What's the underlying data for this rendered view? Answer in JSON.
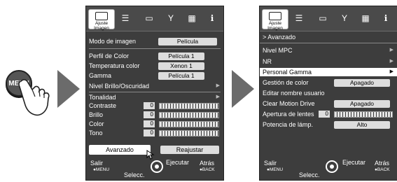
{
  "menu_button": "MENU",
  "panel1": {
    "tab_label": "Ajuste Imagen",
    "picture_mode": {
      "label": "Modo de imagen",
      "value": "Película"
    },
    "rows": [
      {
        "label": "Perfil de Color",
        "value": "Película 1"
      },
      {
        "label": "Temperatura color",
        "value": "Xenon 1"
      },
      {
        "label": "Gamma",
        "value": "Película 1"
      },
      {
        "label": "Nivel Brillo/Oscuridad"
      },
      {
        "label": "Tonalidad"
      }
    ],
    "sliders": [
      {
        "label": "Contraste",
        "value": "0"
      },
      {
        "label": "Brillo",
        "value": "0"
      },
      {
        "label": "Color",
        "value": "0"
      },
      {
        "label": "Tono",
        "value": "0"
      }
    ],
    "advanced_button": "Avanzado",
    "reset_button": "Reajustar"
  },
  "panel2": {
    "tab_label": "Ajuste Imagen",
    "section_header": "> Avanzado",
    "rows": [
      {
        "label": "Nivel MPC"
      },
      {
        "label": "NR"
      },
      {
        "label": "Personal Gamma"
      },
      {
        "label": "Gestión de color",
        "value": "Apagado"
      },
      {
        "label": "Editar nombre usuario"
      },
      {
        "label": "Clear Motion Drive",
        "value": "Apagado"
      },
      {
        "label": "Apertura de lentes",
        "value": "0"
      },
      {
        "label": "Potencia de lámp.",
        "value": "Alto"
      }
    ]
  },
  "footer": {
    "exit": "Salir",
    "exit_key": "●MENU",
    "select": "Selecc.",
    "execute": "Ejecutar",
    "back": "Atrás",
    "back_key": "●BACK"
  },
  "colors": {
    "panel_bg": "#3d3d3d",
    "highlight_bg": "#ffffff",
    "arrow": "#6b6b6b"
  }
}
